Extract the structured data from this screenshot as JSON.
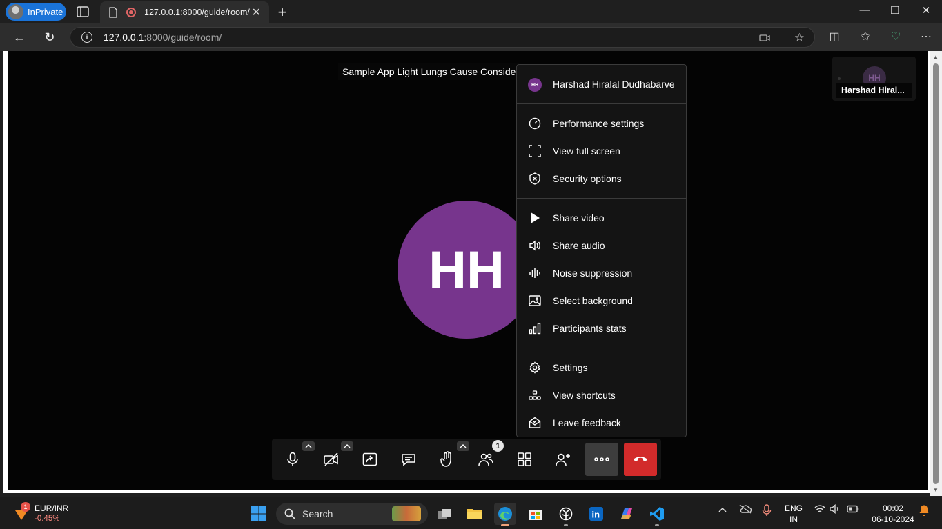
{
  "browser": {
    "inprivate_label": "InPrivate",
    "tab_title": "127.0.0.1:8000/guide/room/",
    "url_host": "127.0.0.1",
    "url_path": ":8000/guide/room/"
  },
  "meeting": {
    "title": "Sample App Light Lungs Cause Consider",
    "main_avatar_initials": "HH",
    "thumbnail_initials": "HH",
    "thumbnail_name": "Harshad Hiral..."
  },
  "menu": {
    "user_initials": "HH",
    "user_name": "Harshad Hiralal Dudhabarve",
    "items": [
      {
        "label": "Performance settings",
        "icon": "gauge-icon"
      },
      {
        "label": "View full screen",
        "icon": "fullscreen-icon"
      },
      {
        "label": "Security options",
        "icon": "shield-icon"
      },
      {
        "label": "Share video",
        "icon": "play-icon"
      },
      {
        "label": "Share audio",
        "icon": "speaker-icon"
      },
      {
        "label": "Noise suppression",
        "icon": "waveform-icon"
      },
      {
        "label": "Select background",
        "icon": "image-icon"
      },
      {
        "label": "Participants stats",
        "icon": "bar-chart-icon"
      },
      {
        "label": "Settings",
        "icon": "gear-icon"
      },
      {
        "label": "View shortcuts",
        "icon": "keyboard-icon"
      },
      {
        "label": "Leave feedback",
        "icon": "feedback-icon"
      }
    ]
  },
  "toolbar": {
    "participants_count": "1",
    "hangup_color": "#d22b2b"
  },
  "taskbar": {
    "weather_badge": "1",
    "currency_pair": "EUR/INR",
    "currency_change": "-0.45%",
    "search_label": "Search",
    "lang_line1": "ENG",
    "lang_line2": "IN",
    "time": "00:02",
    "date": "06-10-2024"
  }
}
